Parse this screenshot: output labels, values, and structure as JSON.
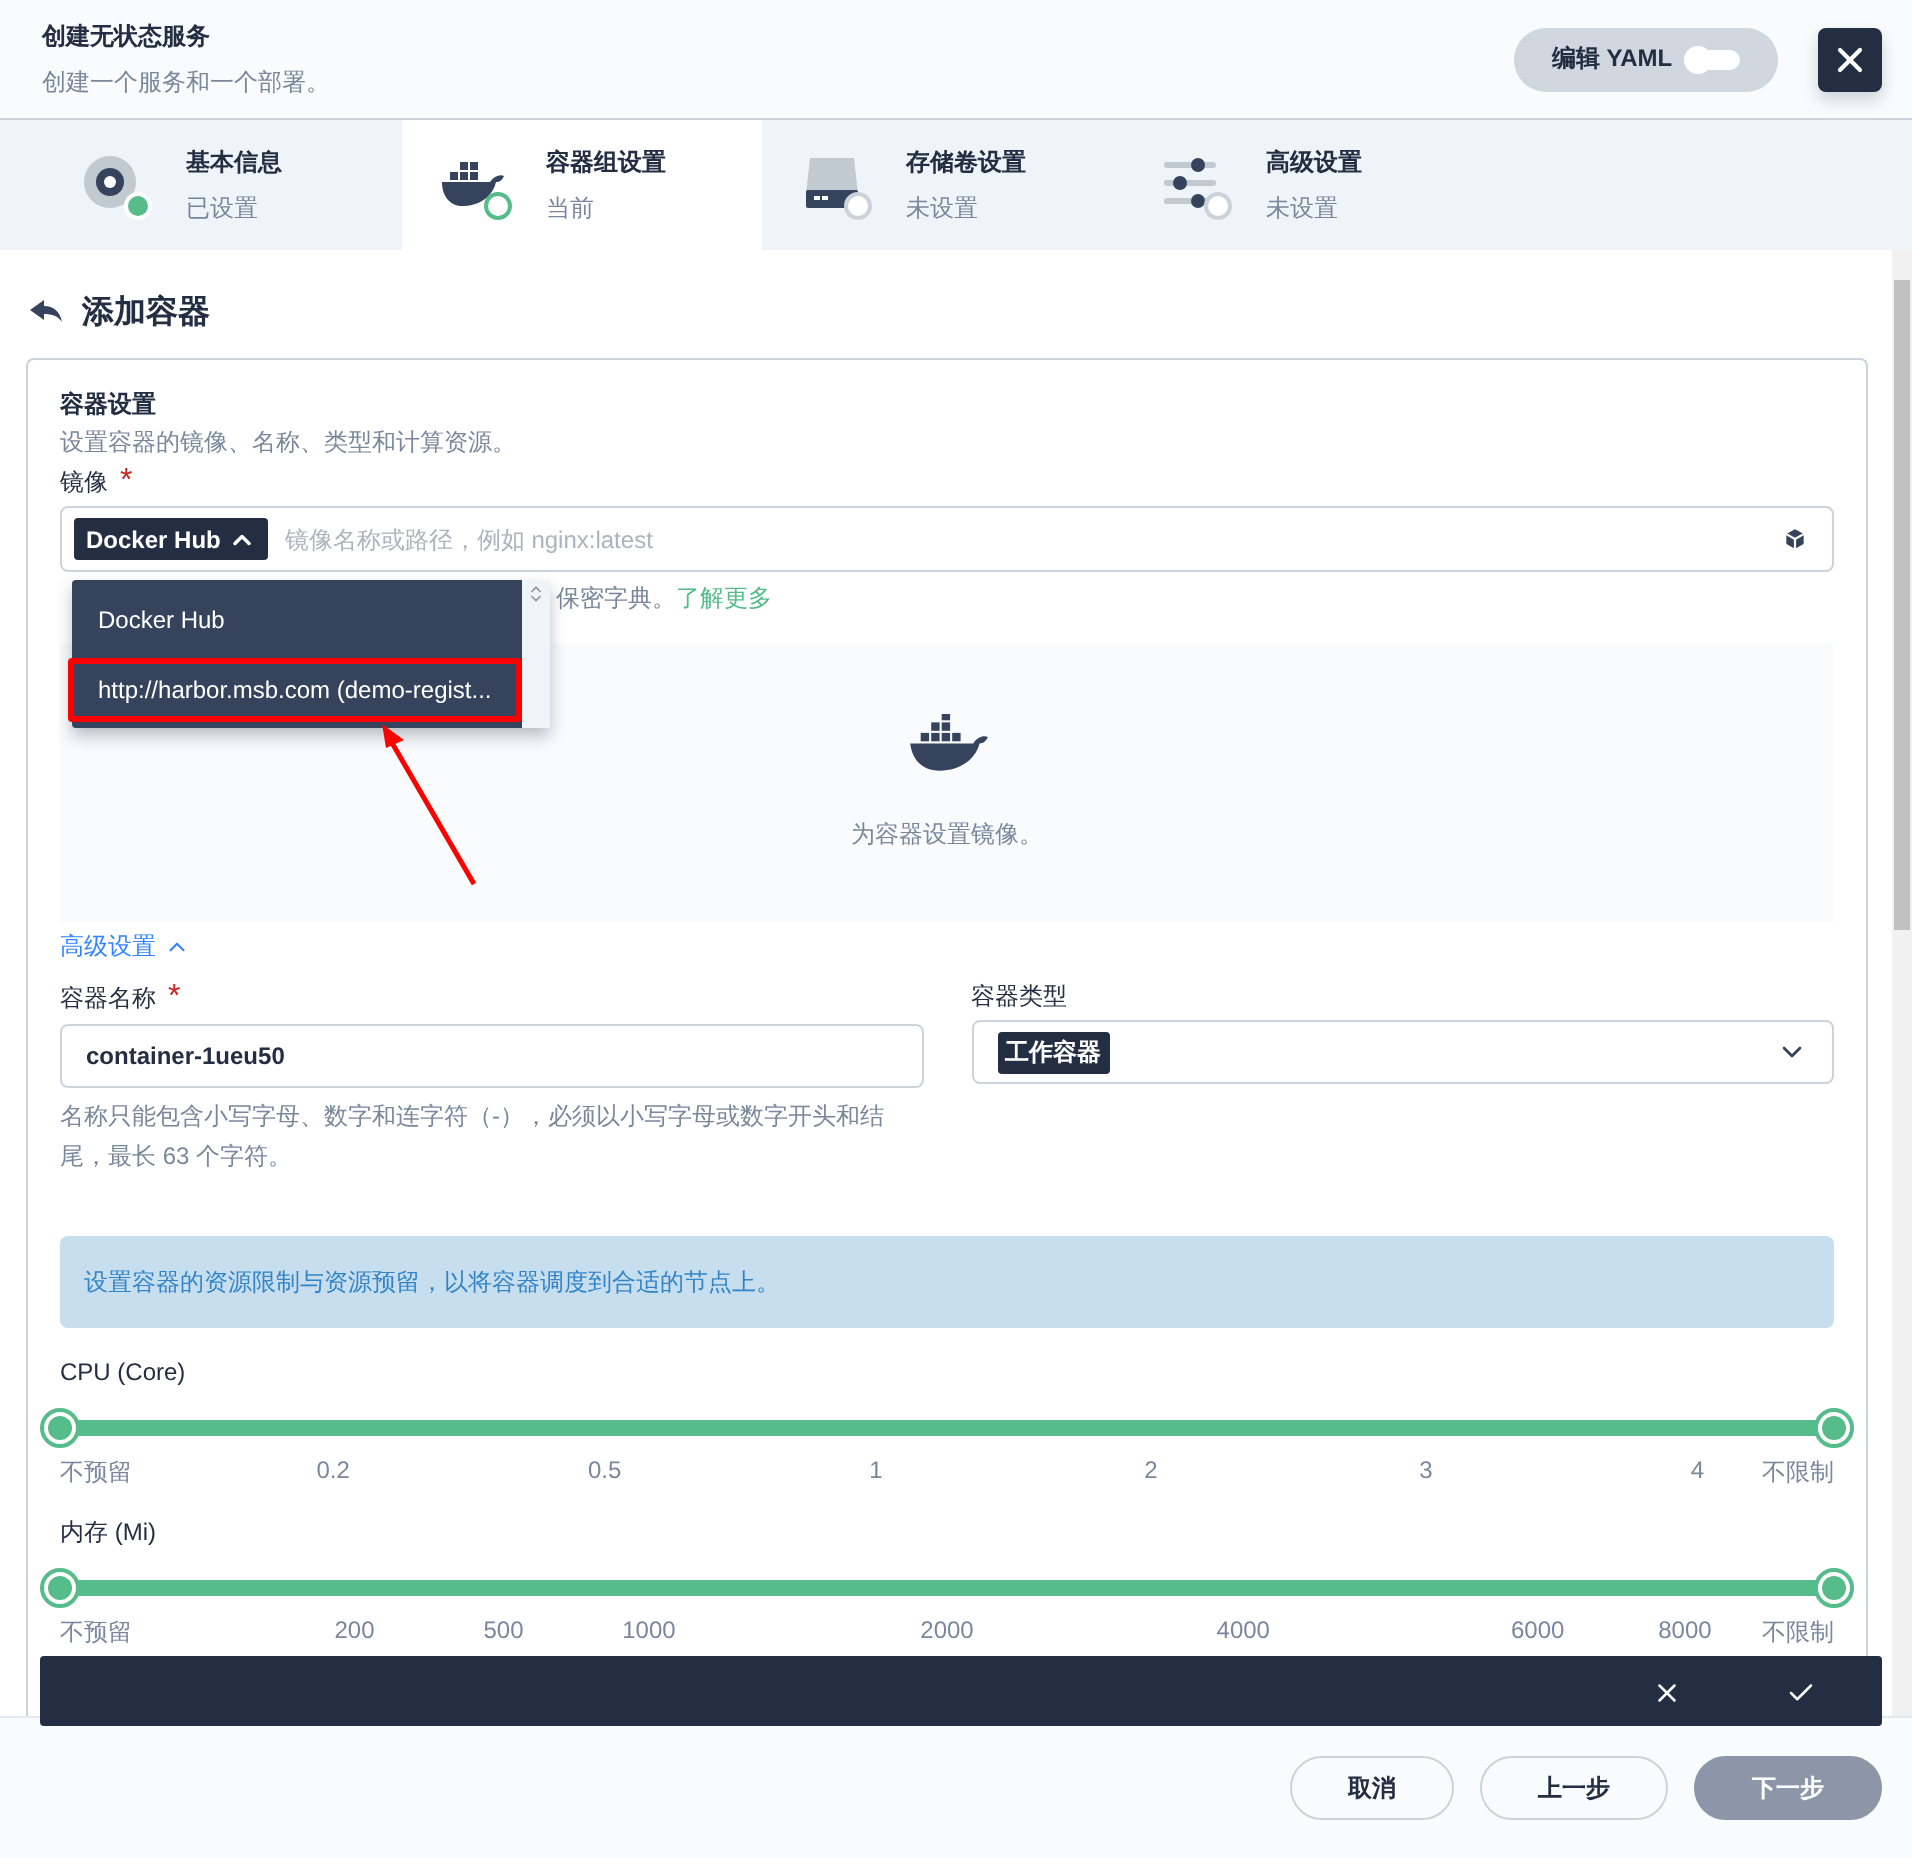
{
  "header": {
    "title": "创建无状态服务",
    "subtitle": "创建一个服务和一个部署。",
    "yaml_button": {
      "label": "编辑 YAML",
      "on": false
    }
  },
  "steps": [
    {
      "title": "基本信息",
      "status": "已设置",
      "kind": "info",
      "completed": true,
      "selected": false
    },
    {
      "title": "容器组设置",
      "status": "当前",
      "kind": "container",
      "completed": false,
      "selected": true
    },
    {
      "title": "存储卷设置",
      "status": "未设置",
      "kind": "storage",
      "completed": false,
      "selected": false
    },
    {
      "title": "高级设置",
      "status": "未设置",
      "kind": "advanced",
      "completed": false,
      "selected": false
    }
  ],
  "page_title": "添加容器",
  "container_settings": {
    "title": "容器设置",
    "description": "设置容器的镜像、名称、类型和计算资源。",
    "image": {
      "label": "镜像",
      "required_mark": "*",
      "registry": "Docker Hub",
      "placeholder": "镜像名称或路径，例如 nginx:latest",
      "hint": "保密字典。",
      "hint_link": "了解更多",
      "empty_text": "为容器设置镜像。",
      "registry_menu": [
        {
          "label": "Docker Hub",
          "annotated": false
        },
        {
          "label": "http://harbor.msb.com (demo-regist...",
          "annotated": true
        }
      ]
    },
    "advanced_toggle": {
      "label": "高级设置",
      "expanded": true
    },
    "name": {
      "label": "容器名称",
      "required_mark": "*",
      "value": "container-1ueu50",
      "hint": "名称只能包含小写字母、数字和连字符（-），必须以小写字母或数字开头和结尾，最长 63 个字符。"
    },
    "type": {
      "label": "容器类型",
      "value": "工作容器"
    },
    "resource_note": "设置容器的资源限制与资源预留，以将容器调度到合适的节点上。",
    "sliders": [
      {
        "label": "CPU (Core)",
        "kind": "cpu",
        "level": 1,
        "ticks": [
          "不预留",
          "0.2",
          "0.5",
          "1",
          "2",
          "3",
          "4",
          "不限制"
        ]
      },
      {
        "label": "内存 (Mi)",
        "kind": "memory",
        "level": 1,
        "ticks": [
          "不预留",
          "200",
          "500",
          "1000",
          "2000",
          "4000",
          "6000",
          "8000",
          "不限制"
        ]
      }
    ]
  },
  "footer": {
    "buttons": [
      {
        "label": "取消",
        "kind": "secondary"
      },
      {
        "label": "上一步",
        "kind": "secondary"
      },
      {
        "label": "下一步",
        "kind": "primary"
      }
    ]
  }
}
